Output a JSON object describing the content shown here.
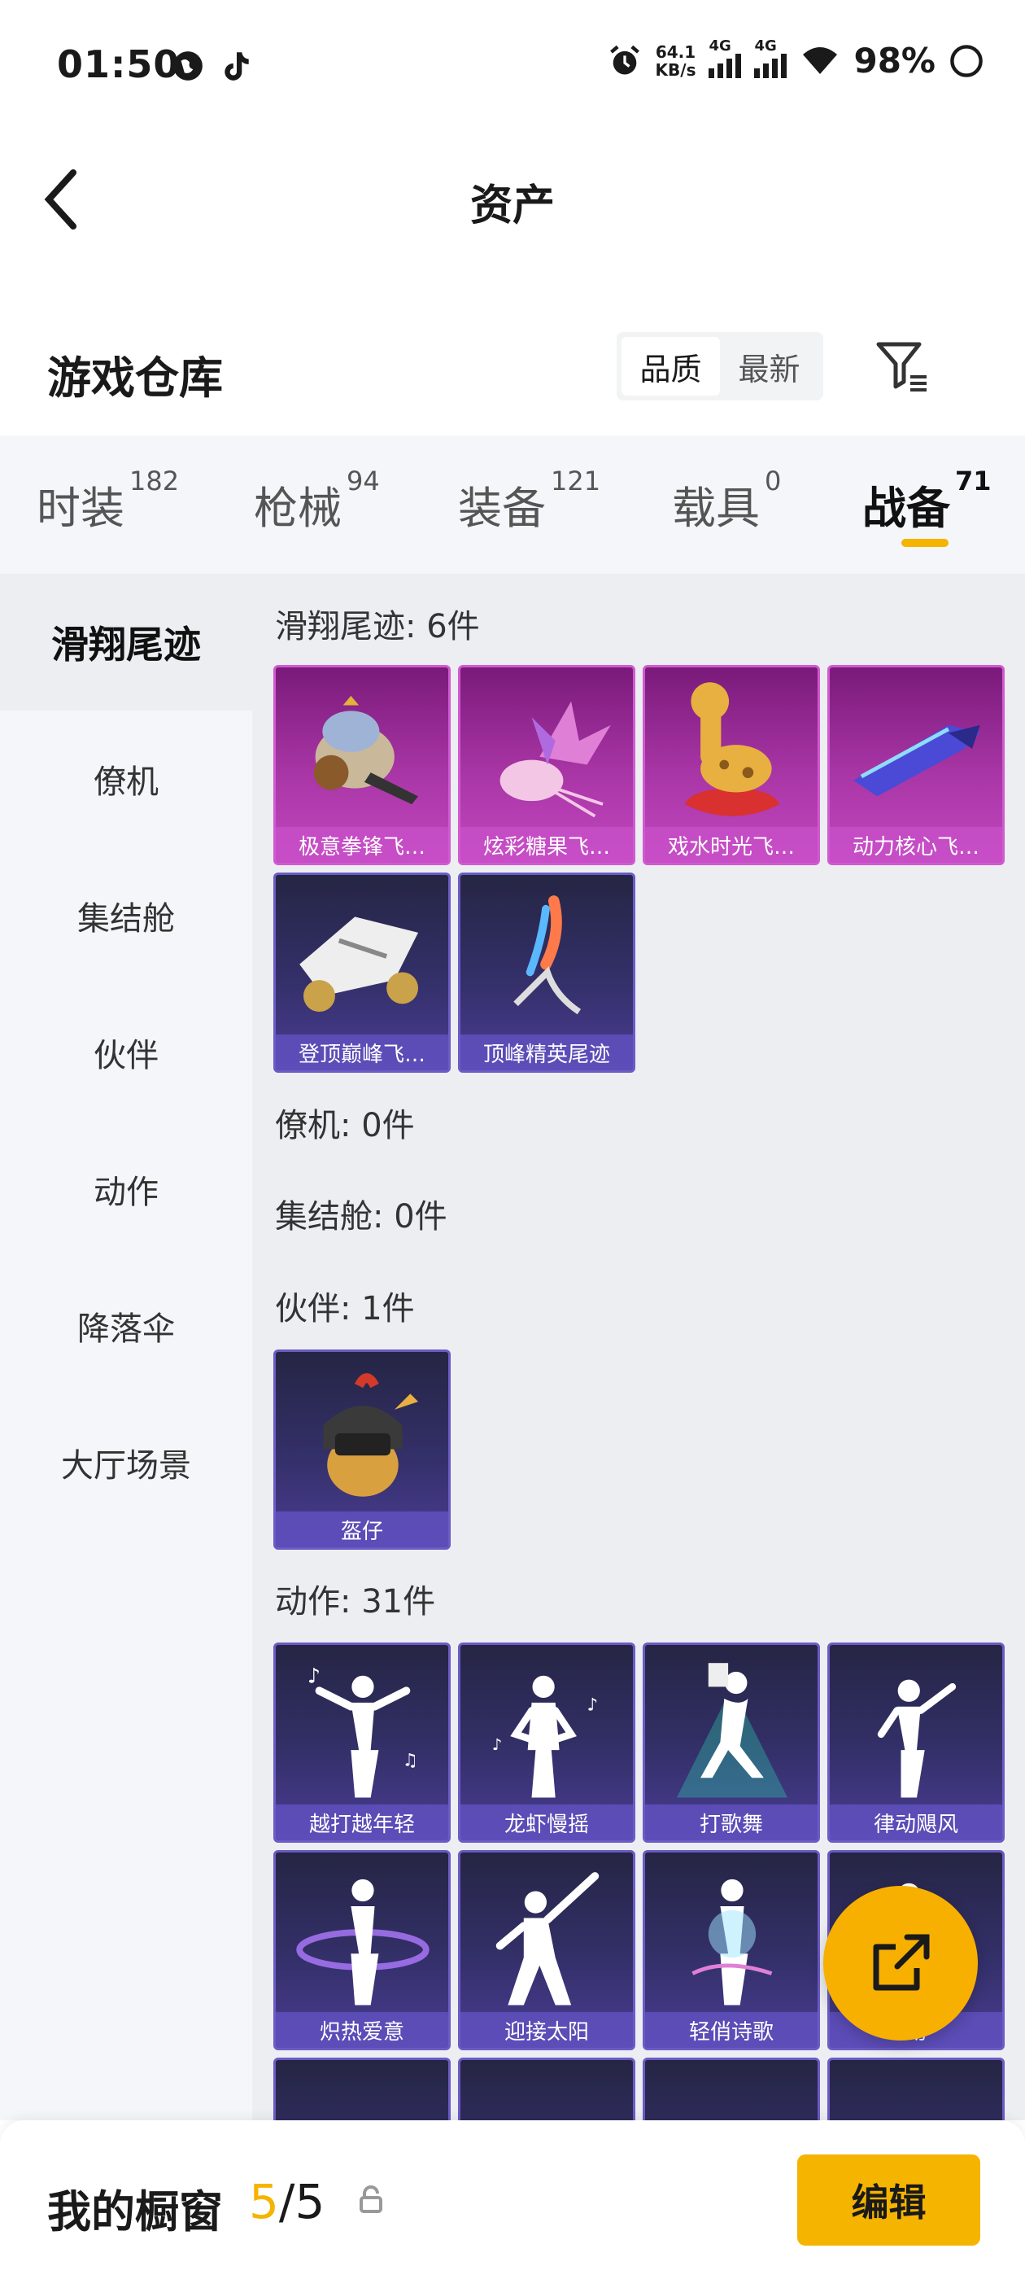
{
  "status_bar": {
    "time": "01:50",
    "net_speed_value": "64.1",
    "net_speed_unit": "KB/s",
    "signal1_label": "4G",
    "signal2_label": "4G",
    "battery": "98%"
  },
  "header": {
    "title": "资产"
  },
  "warehouse": {
    "title": "游戏仓库",
    "sort_quality": "品质",
    "sort_latest": "最新"
  },
  "tabs": [
    {
      "label": "时装",
      "count": "182"
    },
    {
      "label": "枪械",
      "count": "94"
    },
    {
      "label": "装备",
      "count": "121"
    },
    {
      "label": "载具",
      "count": "0"
    },
    {
      "label": "战备",
      "count": "71"
    }
  ],
  "sidebar": {
    "items": [
      "滑翔尾迹",
      "僚机",
      "集结舱",
      "伙伴",
      "动作",
      "降落伞",
      "大厅场景"
    ]
  },
  "sections": {
    "glide": {
      "title": "滑翔尾迹: 6件",
      "items": [
        "极意拳锋飞…",
        "炫彩糖果飞…",
        "戏水时光飞…",
        "动力核心飞…",
        "登顶巅峰飞…",
        "顶峰精英尾迹"
      ]
    },
    "wingman": {
      "title": "僚机: 0件"
    },
    "capsule": {
      "title": "集结舱: 0件"
    },
    "partner": {
      "title": "伙伴: 1件",
      "items": [
        "盔仔"
      ]
    },
    "emote": {
      "title": "动作: 31件",
      "items": [
        "越打越年轻",
        "龙虾慢摇",
        "打歌舞",
        "律动飓风",
        "炽热爱意",
        "迎接太阳",
        "轻俏诗歌",
        "动"
      ]
    }
  },
  "bottom": {
    "label": "我的橱窗",
    "current": "5",
    "sep_total": "/5",
    "edit": "编辑"
  },
  "colors": {
    "accent": "#f5b400",
    "legendary_card": "#a936a6",
    "epic_card": "#4a3d94"
  }
}
